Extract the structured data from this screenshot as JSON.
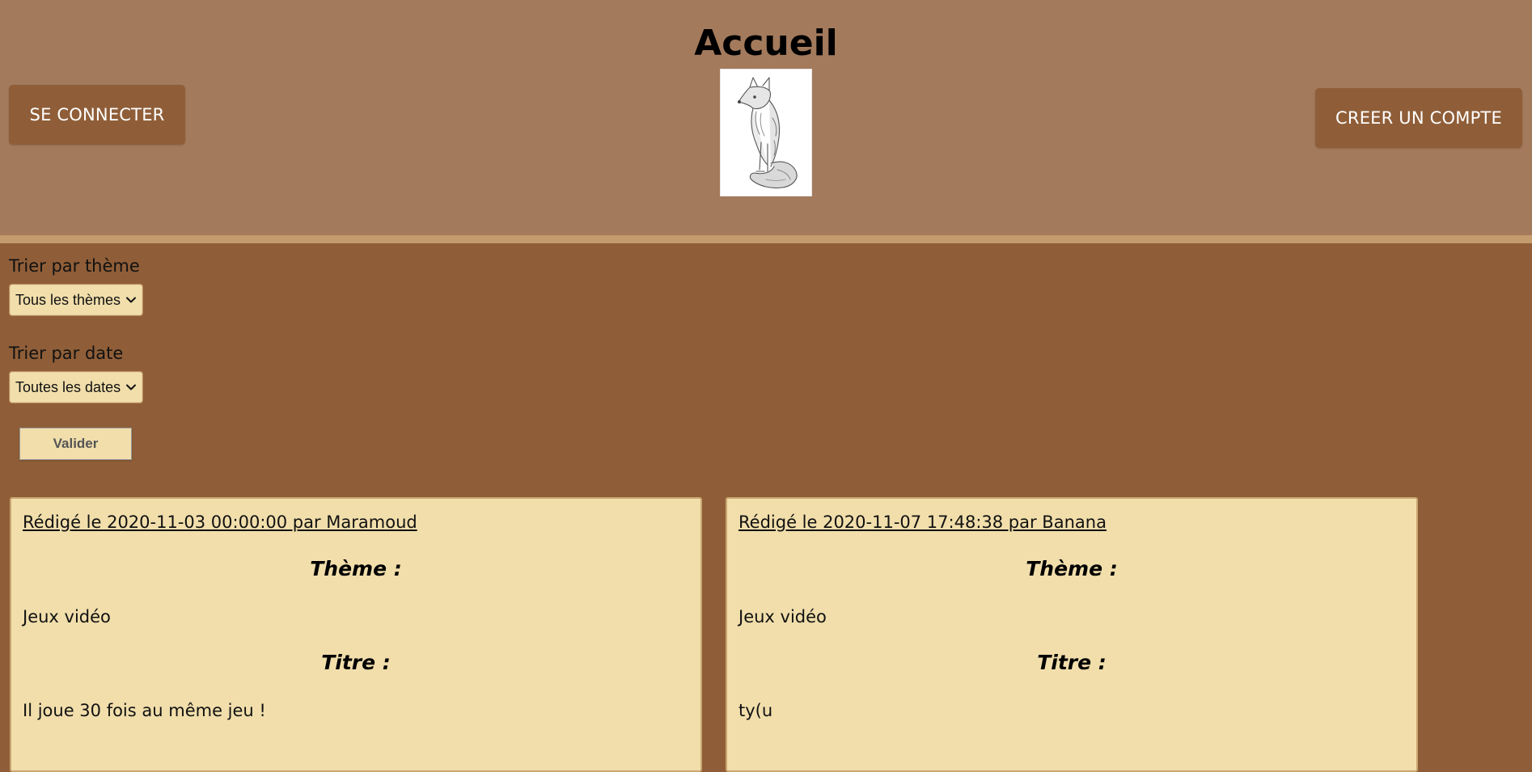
{
  "header": {
    "title": "Accueil",
    "login_label": "SE CONNECTER",
    "register_label": "CREER UN COMPTE"
  },
  "filters": {
    "theme_label": "Trier par thème",
    "theme_selected": "Tous les thèmes",
    "date_label": "Trier par date",
    "date_selected": "Toutes les dates",
    "submit_label": "Valider"
  },
  "articles": [
    {
      "meta": "Rédigé le 2020-11-03 00:00:00 par Maramoud",
      "theme_heading": "Thème :",
      "theme": "Jeux vidéo",
      "title_heading": "Titre :",
      "title": "Il joue 30 fois au même jeu !"
    },
    {
      "meta": "Rédigé le 2020-11-07 17:48:38 par Banana",
      "theme_heading": "Thème :",
      "theme": "Jeux vidéo",
      "title_heading": "Titre :",
      "title": "ty(u"
    }
  ],
  "colors": {
    "header_bg": "#a37a5c",
    "page_bg": "#8f5e38",
    "card_bg": "#f1deab",
    "button_bg": "#8f5e38"
  },
  "icons": {
    "logo": "fox-sketch-icon",
    "select_arrow": "chevron-down-icon"
  }
}
